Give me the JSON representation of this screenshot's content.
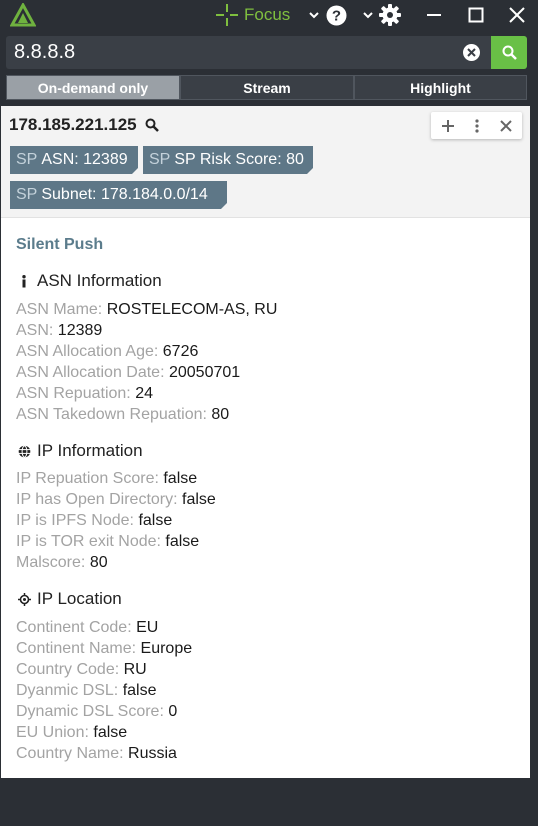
{
  "titlebar": {
    "focus_label": "Focus",
    "colors": {
      "brand": "#7fbf3f",
      "background": "#2b2f35"
    }
  },
  "search": {
    "value": "8.8.8.8"
  },
  "tabs": [
    {
      "label": "On-demand only",
      "active": true
    },
    {
      "label": "Stream",
      "active": false
    },
    {
      "label": "Highlight",
      "active": false
    }
  ],
  "entity": {
    "value": "178.185.221.125",
    "tags": [
      {
        "prefix": "SP",
        "label": "ASN: 12389"
      },
      {
        "prefix": "SP",
        "label": "SP Risk Score: 80"
      },
      {
        "prefix": "SP",
        "label": "Subnet: 178.184.0.0/14"
      }
    ],
    "tag_color": "#5e7787"
  },
  "integration": {
    "title": "Silent Push",
    "title_color": "#5b7c8c",
    "sections": [
      {
        "title": "ASN Information",
        "icon": "info-icon",
        "rows": [
          {
            "key": "ASN Mame:",
            "value": "ROSTELECOM-AS, RU"
          },
          {
            "key": "ASN:",
            "value": "12389"
          },
          {
            "key": "ASN Allocation Age:",
            "value": "6726"
          },
          {
            "key": "ASN Allocation Date:",
            "value": "20050701"
          },
          {
            "key": "ASN Repuation:",
            "value": "24"
          },
          {
            "key": "ASN Takedown Repuation:",
            "value": "80"
          }
        ]
      },
      {
        "title": "IP Information",
        "icon": "globe-icon",
        "rows": [
          {
            "key": "IP Repuation Score:",
            "value": "false"
          },
          {
            "key": "IP has Open Directory:",
            "value": "false"
          },
          {
            "key": "IP is IPFS Node:",
            "value": "false"
          },
          {
            "key": "IP is TOR exit Node:",
            "value": "false"
          },
          {
            "key": "Malscore:",
            "value": "80"
          }
        ]
      },
      {
        "title": "IP Location",
        "icon": "location-crosshair-icon",
        "rows": [
          {
            "key": "Continent Code:",
            "value": "EU"
          },
          {
            "key": "Continent Name:",
            "value": "Europe"
          },
          {
            "key": "Country Code:",
            "value": "RU"
          },
          {
            "key": "Dyanmic DSL:",
            "value": "false"
          },
          {
            "key": "Dynamic DSL Score:",
            "value": "0"
          },
          {
            "key": "EU Union:",
            "value": "false"
          },
          {
            "key": "Country Name:",
            "value": "Russia"
          }
        ]
      }
    ]
  }
}
